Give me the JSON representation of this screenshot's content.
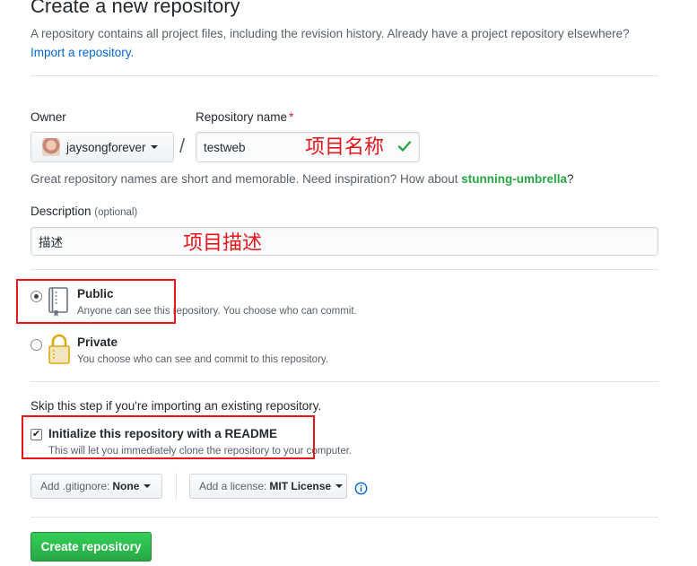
{
  "header": {
    "title": "Create a new repository",
    "description": "A repository contains all project files, including the revision history. Already have a project repository elsewhere?",
    "import_link": "Import a repository."
  },
  "owner": {
    "label": "Owner",
    "value": "jaysongforever"
  },
  "repo_name": {
    "label": "Repository name",
    "required_mark": "*",
    "value": "testweb",
    "status_icon": "check-icon"
  },
  "slash": "/",
  "name_hint": {
    "prefix": "Great repository names are short and memorable. Need inspiration? How about",
    "suggestion": "stunning-umbrella",
    "suffix": "?"
  },
  "description_field": {
    "label": "Description",
    "optional": "(optional)",
    "value": "描述"
  },
  "annotations": {
    "name_note": "项目名称",
    "desc_note": "项目描述"
  },
  "visibility": {
    "selected": "public",
    "options": [
      {
        "id": "public",
        "title": "Public",
        "note": "Anyone can see this repository. You choose who can commit.",
        "icon": "repo-book-icon"
      },
      {
        "id": "private",
        "title": "Private",
        "note": "You choose who can see and commit to this repository.",
        "icon": "lock-icon"
      }
    ]
  },
  "init": {
    "skip_text": "Skip this step if you're importing an existing repository.",
    "checked": true,
    "title": "Initialize this repository with a README",
    "note": "This will let you immediately clone the repository to your computer."
  },
  "gitignore": {
    "prefix": "Add .gitignore:",
    "value": "None"
  },
  "license": {
    "prefix": "Add a license:",
    "value": "MIT License"
  },
  "submit_label": "Create repository",
  "colors": {
    "accent_green": "#28a745",
    "link_blue": "#0366d6",
    "annotation_red": "#e8151a"
  }
}
